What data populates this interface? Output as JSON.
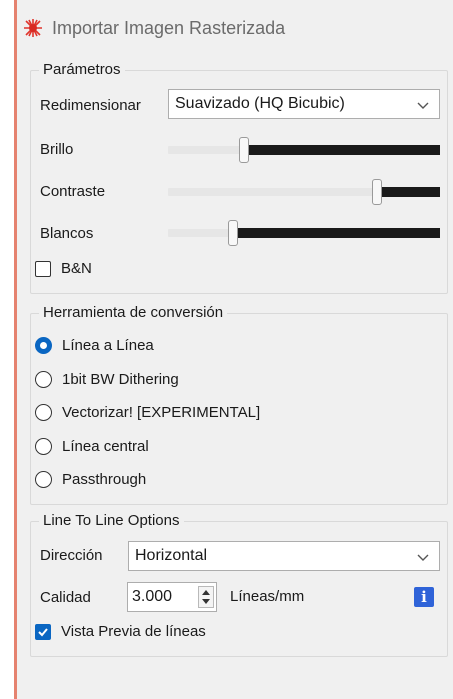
{
  "title": "Importar Imagen Rasterizada",
  "parametros": {
    "legend": "Parámetros",
    "resize_label": "Redimensionar",
    "resize_value": "Suavizado (HQ Bicubic)",
    "brightness_label": "Brillo",
    "brightness_value": 0.27,
    "contrast_label": "Contraste",
    "contrast_value": 0.78,
    "whites_label": "Blancos",
    "whites_value": 0.23,
    "bw_label": "B&N",
    "bw_checked": false
  },
  "herramienta": {
    "legend": "Herramienta de conversión",
    "options": [
      {
        "label": "Línea a Línea",
        "selected": true
      },
      {
        "label": "1bit BW Dithering",
        "selected": false
      },
      {
        "label": "Vectorizar! [EXPERIMENTAL]",
        "selected": false
      },
      {
        "label": "Línea central",
        "selected": false
      },
      {
        "label": "Passthrough",
        "selected": false
      }
    ]
  },
  "line_options": {
    "legend": "Line To Line Options",
    "direction_label": "Dirección",
    "direction_value": "Horizontal",
    "quality_label": "Calidad",
    "quality_value": "3.000",
    "quality_unit": "Líneas/mm",
    "info_icon": "i",
    "preview_label": "Vista Previa de líneas",
    "preview_checked": true
  },
  "colors": {
    "accent": "#0a66c2",
    "info": "#2f63d8",
    "left_accent": "#e5826f"
  }
}
